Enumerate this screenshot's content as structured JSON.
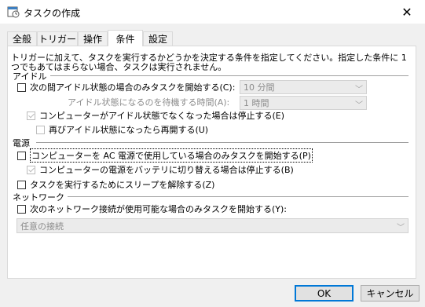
{
  "window": {
    "title": "タスクの作成"
  },
  "tabs": [
    {
      "label": "全般"
    },
    {
      "label": "トリガー"
    },
    {
      "label": "操作"
    },
    {
      "label": "条件"
    },
    {
      "label": "設定"
    }
  ],
  "description": "トリガーに加えて、タスクを実行するかどうかを決定する条件を指定してください。指定した条件に 1 つでもあてはまらない場合、タスクは実行されません。",
  "idle": {
    "section_title": "アイドル",
    "start_only_if_idle": {
      "label": "次の間アイドル状態の場合のみタスクを開始する(C):",
      "checked": false,
      "value": "10 分間"
    },
    "wait_for_idle": {
      "label": "アイドル状態になるのを待機する時間(A):",
      "value": "1 時間"
    },
    "stop_if_not_idle": {
      "label": "コンピューターがアイドル状態でなくなった場合は停止する(E)",
      "checked": true
    },
    "restart_if_idle": {
      "label": "再びアイドル状態になったら再開する(U)",
      "checked": false
    }
  },
  "power": {
    "section_title": "電源",
    "ac_only": {
      "label": "コンピューターを AC 電源で使用している場合のみタスクを開始する(P)",
      "checked": false
    },
    "stop_on_battery": {
      "label": "コンピューターの電源をバッテリに切り替える場合は停止する(B)",
      "checked": true
    },
    "wake": {
      "label": "タスクを実行するためにスリープを解除する(Z)",
      "checked": false
    }
  },
  "network": {
    "section_title": "ネットワーク",
    "network_only": {
      "label": "次のネットワーク接続が使用可能な場合のみタスクを開始する(Y):",
      "checked": false
    },
    "connection": "任意の接続"
  },
  "buttons": {
    "ok": "OK",
    "cancel": "キャンセル"
  }
}
